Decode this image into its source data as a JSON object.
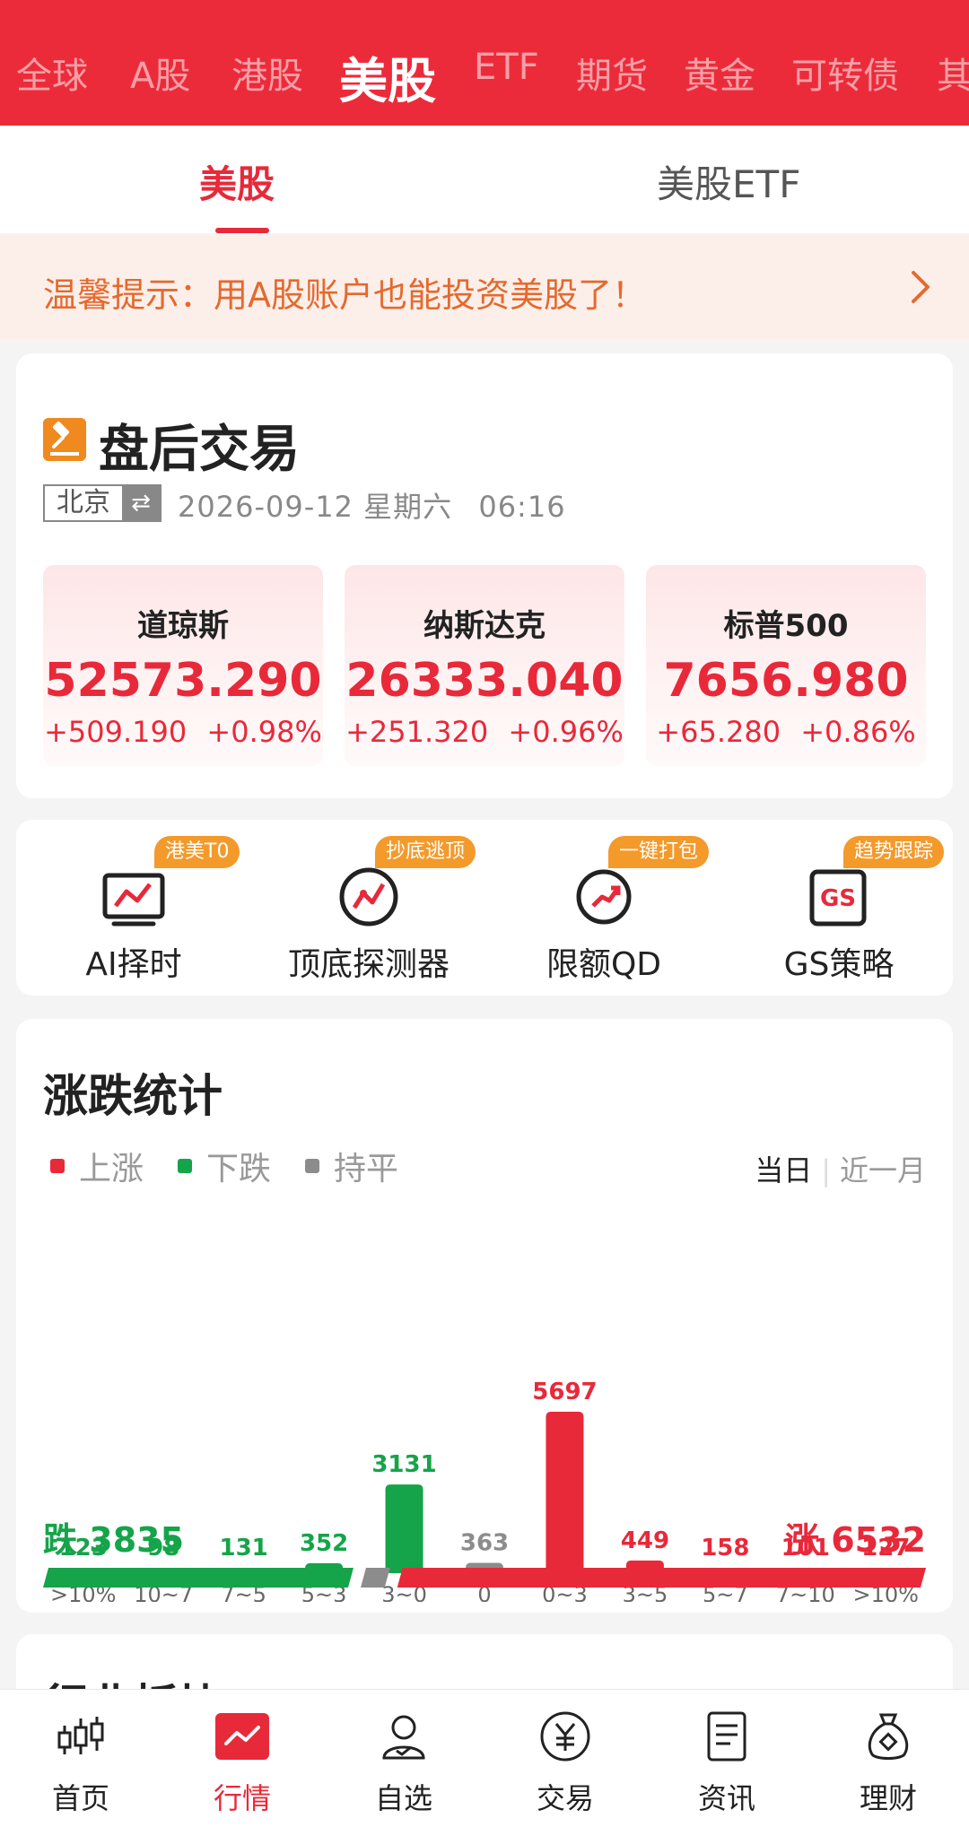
{
  "market_tabs": [
    "全球",
    "A股",
    "港股",
    "美股",
    "ETF",
    "期货",
    "黄金",
    "可转债",
    "其"
  ],
  "active_market": "美股",
  "sub_tabs": [
    "美股",
    "美股ETF"
  ],
  "notice": {
    "text": "温馨提示：用A股账户也能投资美股了！",
    "icon": "chevron-right-icon"
  },
  "after_hours": {
    "title": "盘后交易",
    "city": "北京",
    "swap_glyph": "⇄",
    "date": "2026-09-12",
    "weekday": "星期六",
    "time": "06:16",
    "indices": [
      {
        "name": "道琼斯",
        "value": "52573.290",
        "change": "+509.190",
        "pct": "+0.98%"
      },
      {
        "name": "纳斯达克",
        "value": "26333.040",
        "change": "+251.320",
        "pct": "+0.96%"
      },
      {
        "name": "标普500",
        "value": "7656.980",
        "change": "+65.280",
        "pct": "+0.86%"
      }
    ]
  },
  "tools": [
    {
      "badge": "港美T0",
      "label": "AI择时",
      "icon": "ai-timing-icon"
    },
    {
      "badge": "抄底逃顶",
      "label": "顶底探测器",
      "icon": "top-bottom-detector-icon"
    },
    {
      "badge": "一键打包",
      "label": "限额QD",
      "icon": "quota-qd-icon"
    },
    {
      "badge": "趋势跟踪",
      "label": "GS策略",
      "icon": "gs-strategy-icon"
    }
  ],
  "stats": {
    "title": "涨跌统计",
    "legend": [
      {
        "label": "上涨",
        "color": "#e8293a"
      },
      {
        "label": "下跌",
        "color": "#15a449"
      },
      {
        "label": "持平",
        "color": "#8c8c8c"
      }
    ],
    "range_active": "当日",
    "range_other": "近一月",
    "fall_label": "跌",
    "fall_total": "3835",
    "rise_label": "涨",
    "rise_total": "6532"
  },
  "chart_data": {
    "type": "bar",
    "categories": [
      ">10%",
      "10~7",
      "7~5",
      "5~3",
      "3~0",
      "0",
      "0~3",
      "3~5",
      "5~7",
      "7~10",
      ">10%"
    ],
    "values": [
      123,
      98,
      131,
      352,
      3131,
      363,
      5697,
      449,
      158,
      101,
      127
    ],
    "colors": [
      "#15a449",
      "#15a449",
      "#15a449",
      "#15a449",
      "#15a449",
      "#8c8c8c",
      "#e8293a",
      "#e8293a",
      "#e8293a",
      "#e8293a",
      "#e8293a"
    ],
    "split": {
      "fall": 3835,
      "flat": 363,
      "rise": 6532
    },
    "title": "",
    "xlabel": "",
    "ylabel": ""
  },
  "next_section": {
    "title": "行业板块"
  },
  "bottom_nav": [
    {
      "label": "首页",
      "icon": "candlestick-icon",
      "active": false
    },
    {
      "label": "行情",
      "icon": "market-chart-icon",
      "active": true
    },
    {
      "label": "自选",
      "icon": "user-watchlist-icon",
      "active": false
    },
    {
      "label": "交易",
      "icon": "yuan-coin-icon",
      "active": false
    },
    {
      "label": "资讯",
      "icon": "news-document-icon",
      "active": false
    },
    {
      "label": "理财",
      "icon": "money-bag-icon",
      "active": false
    }
  ]
}
